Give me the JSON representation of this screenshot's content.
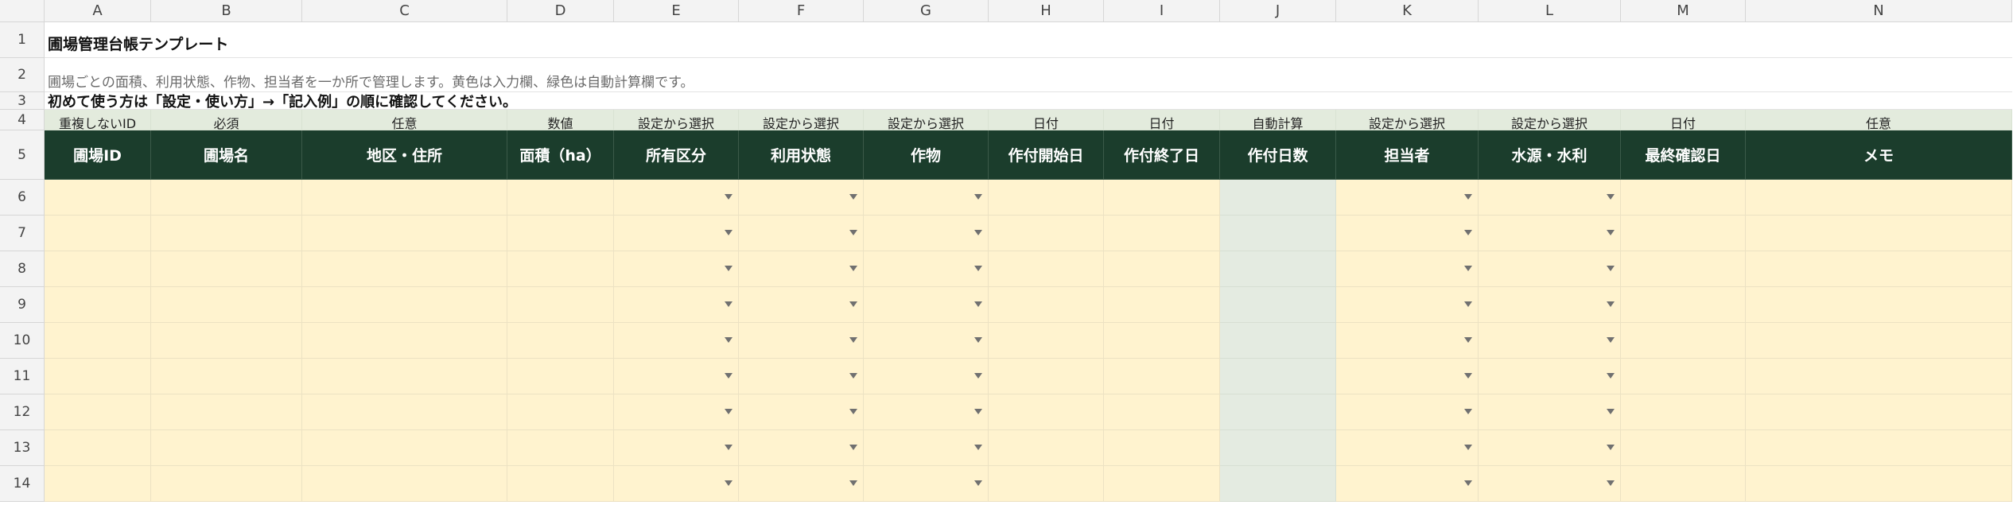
{
  "columns": [
    "A",
    "B",
    "C",
    "D",
    "E",
    "F",
    "G",
    "H",
    "I",
    "J",
    "K",
    "L",
    "M",
    "N"
  ],
  "row_numbers": [
    "1",
    "2",
    "3",
    "4",
    "5",
    "6",
    "7",
    "8",
    "9",
    "10",
    "11",
    "12",
    "13",
    "14"
  ],
  "title": "圃場管理台帳テンプレート",
  "description": "圃場ごとの面積、利用状態、作物、担当者を一か所で管理します。黄色は入力欄、緑色は自動計算欄です。",
  "guide": "初めて使う方は「設定・使い方」→「記入例」の順に確認してください。",
  "hints": [
    "重複しないID",
    "必須",
    "任意",
    "数値",
    "設定から選択",
    "設定から選択",
    "設定から選択",
    "日付",
    "日付",
    "自動計算",
    "設定から選択",
    "設定から選択",
    "日付",
    "任意"
  ],
  "headers": [
    "圃場ID",
    "圃場名",
    "地区・住所",
    "面積（ha）",
    "所有区分",
    "利用状態",
    "作物",
    "作付開始日",
    "作付終了日",
    "作付日数",
    "担当者",
    "水源・水利",
    "最終確認日",
    "メモ"
  ],
  "column_types": [
    "input",
    "input",
    "input",
    "input",
    "dropdown",
    "dropdown",
    "dropdown",
    "input",
    "input",
    "calc",
    "dropdown",
    "dropdown",
    "input",
    "input"
  ],
  "colors": {
    "header_bg": "#1b3d2c",
    "hint_bg": "#e3ebdd",
    "input_bg": "#fff3cf",
    "calc_bg": "#e4ebe1"
  }
}
